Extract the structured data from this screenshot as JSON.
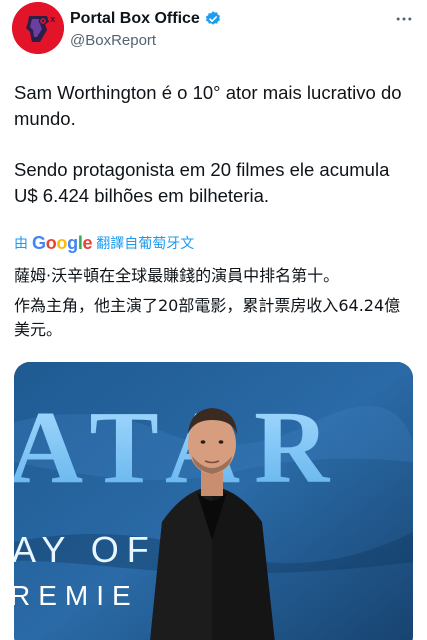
{
  "account": {
    "display_name": "Portal Box Office",
    "handle": "@BoxReport",
    "avatar": "portal-box-office-logo",
    "verified_icon": "verified-badge-icon",
    "more_icon": "more-horizontal-icon"
  },
  "tweet": {
    "para1": "Sam Worthington é o 10° ator mais lucrativo do mundo.",
    "para2": "Sendo protagonista em 20 filmes ele acumula U$ 6.424 bilhões em bilheteria."
  },
  "translation": {
    "by": "由",
    "provider": "Google",
    "service": "翻譯自葡萄牙文",
    "line1": "薩姆·沃辛頓在全球最賺錢的演員中排名第十。",
    "line2": "作為主角，他主演了20部電影，累計票房收入64.24億美元。"
  },
  "media": {
    "backdrop_lines": [
      "ATAR",
      "AY OF TER",
      "REMIE"
    ]
  },
  "colors": {
    "accent": "#1d9bf0",
    "avatar_bg": "#e3142a",
    "backdrop_blue": "#2a6aa6"
  }
}
